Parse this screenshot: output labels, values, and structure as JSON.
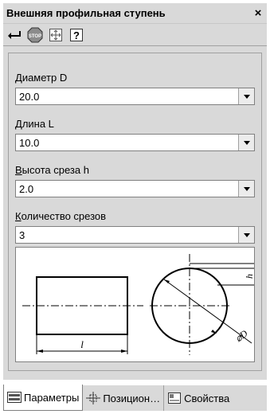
{
  "window": {
    "title": "Внешняя профильная ступень",
    "close_label": "×"
  },
  "toolbar": {
    "buttons": [
      {
        "name": "enter-icon"
      },
      {
        "name": "stop-icon",
        "text": "STOP"
      },
      {
        "name": "fit-icon"
      },
      {
        "name": "help-icon",
        "text": "?"
      }
    ]
  },
  "fields": [
    {
      "label_underlined": "Д",
      "label_rest": "иаметр D",
      "value": "20.0"
    },
    {
      "label_underlined": "Д",
      "label_rest": "лина L",
      "value": "10.0"
    },
    {
      "label_underlined": "В",
      "label_rest": "ысота среза h",
      "value": "2.0"
    },
    {
      "label_underlined": "К",
      "label_rest": "оличество срезов",
      "value": "3"
    }
  ],
  "preview": {
    "length_label": "l",
    "height_label": "h",
    "diameter_label": "⌀D"
  },
  "tabs": [
    {
      "label": "Параметры",
      "active": true
    },
    {
      "label": "Позицион…",
      "active": false
    },
    {
      "label": "Свойства",
      "active": false
    }
  ]
}
